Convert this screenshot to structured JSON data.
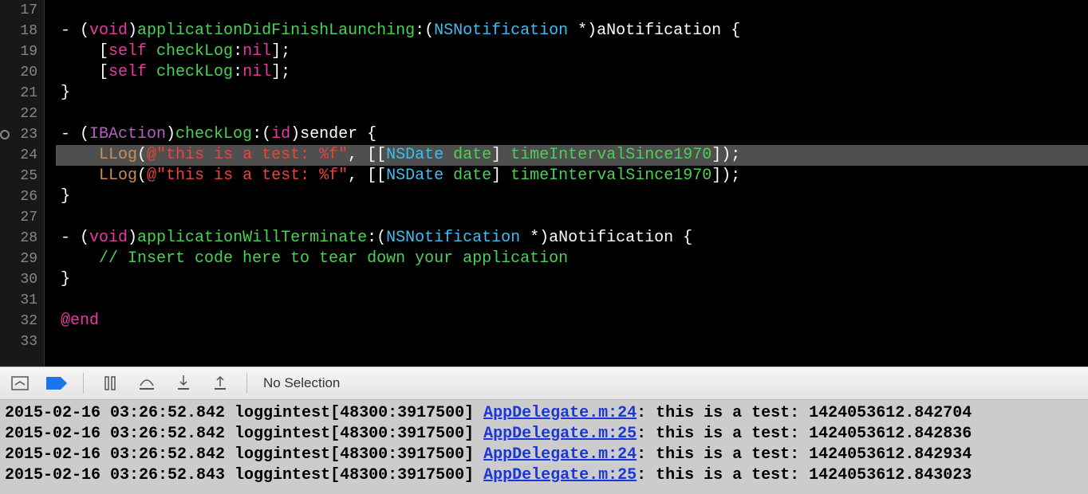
{
  "editor": {
    "line_numbers": [
      "17",
      "18",
      "19",
      "20",
      "21",
      "22",
      "23",
      "24",
      "25",
      "26",
      "27",
      "28",
      "29",
      "30",
      "31",
      "32",
      "33"
    ],
    "breakpoint_line_index": 6,
    "highlight_line_index": 7,
    "lines": [
      {
        "tokens": []
      },
      {
        "tokens": [
          {
            "t": "- (",
            "c": "k-plain"
          },
          {
            "t": "void",
            "c": "k-void"
          },
          {
            "t": ")",
            "c": "k-plain"
          },
          {
            "t": "applicationDidFinishLaunching",
            "c": "k-type"
          },
          {
            "t": ":(",
            "c": "k-plain"
          },
          {
            "t": "NSNotification",
            "c": "k-typeNS"
          },
          {
            "t": " *)aNotification {",
            "c": "k-plain"
          }
        ]
      },
      {
        "tokens": [
          {
            "t": "    [",
            "c": "k-plain"
          },
          {
            "t": "self",
            "c": "k-self"
          },
          {
            "t": " ",
            "c": "k-plain"
          },
          {
            "t": "checkLog",
            "c": "k-msg"
          },
          {
            "t": ":",
            "c": "k-plain"
          },
          {
            "t": "nil",
            "c": "k-nil"
          },
          {
            "t": "];",
            "c": "k-plain"
          }
        ]
      },
      {
        "tokens": [
          {
            "t": "    [",
            "c": "k-plain"
          },
          {
            "t": "self",
            "c": "k-self"
          },
          {
            "t": " ",
            "c": "k-plain"
          },
          {
            "t": "checkLog",
            "c": "k-msg"
          },
          {
            "t": ":",
            "c": "k-plain"
          },
          {
            "t": "nil",
            "c": "k-nil"
          },
          {
            "t": "];",
            "c": "k-plain"
          }
        ]
      },
      {
        "tokens": [
          {
            "t": "}",
            "c": "k-plain"
          }
        ]
      },
      {
        "tokens": []
      },
      {
        "tokens": [
          {
            "t": "- (",
            "c": "k-plain"
          },
          {
            "t": "IBAction",
            "c": "k-ib"
          },
          {
            "t": ")",
            "c": "k-plain"
          },
          {
            "t": "checkLog",
            "c": "k-type"
          },
          {
            "t": ":(",
            "c": "k-plain"
          },
          {
            "t": "id",
            "c": "k-id"
          },
          {
            "t": ")sender {",
            "c": "k-plain"
          }
        ]
      },
      {
        "tokens": [
          {
            "t": "    ",
            "c": "k-plain"
          },
          {
            "t": "LLog",
            "c": "k-llog"
          },
          {
            "t": "(",
            "c": "k-plain"
          },
          {
            "t": "@\"this is a test: %f\"",
            "c": "k-str"
          },
          {
            "t": ", [[",
            "c": "k-plain"
          },
          {
            "t": "NSDate",
            "c": "k-typeNS"
          },
          {
            "t": " ",
            "c": "k-plain"
          },
          {
            "t": "date",
            "c": "k-msg"
          },
          {
            "t": "] ",
            "c": "k-plain"
          },
          {
            "t": "timeIntervalSince1970",
            "c": "k-msg"
          },
          {
            "t": "]);",
            "c": "k-plain"
          }
        ]
      },
      {
        "tokens": [
          {
            "t": "    ",
            "c": "k-plain"
          },
          {
            "t": "LLog",
            "c": "k-llog"
          },
          {
            "t": "(",
            "c": "k-plain"
          },
          {
            "t": "@\"this is a test: %f\"",
            "c": "k-str"
          },
          {
            "t": ", [[",
            "c": "k-plain"
          },
          {
            "t": "NSDate",
            "c": "k-typeNS"
          },
          {
            "t": " ",
            "c": "k-plain"
          },
          {
            "t": "date",
            "c": "k-msg"
          },
          {
            "t": "] ",
            "c": "k-plain"
          },
          {
            "t": "timeIntervalSince1970",
            "c": "k-msg"
          },
          {
            "t": "]);",
            "c": "k-plain"
          }
        ]
      },
      {
        "tokens": [
          {
            "t": "}",
            "c": "k-plain"
          }
        ]
      },
      {
        "tokens": []
      },
      {
        "tokens": [
          {
            "t": "- (",
            "c": "k-plain"
          },
          {
            "t": "void",
            "c": "k-void"
          },
          {
            "t": ")",
            "c": "k-plain"
          },
          {
            "t": "applicationWillTerminate",
            "c": "k-type"
          },
          {
            "t": ":(",
            "c": "k-plain"
          },
          {
            "t": "NSNotification",
            "c": "k-typeNS"
          },
          {
            "t": " *)aNotification {",
            "c": "k-plain"
          }
        ]
      },
      {
        "tokens": [
          {
            "t": "    // Insert code here to tear down your application",
            "c": "k-comment"
          }
        ]
      },
      {
        "tokens": [
          {
            "t": "}",
            "c": "k-plain"
          }
        ]
      },
      {
        "tokens": []
      },
      {
        "tokens": [
          {
            "t": "@end",
            "c": "k-end"
          }
        ]
      },
      {
        "tokens": []
      }
    ]
  },
  "debug_bar": {
    "label": "No Selection"
  },
  "console": {
    "entries": [
      {
        "prefix": "2015-02-16 03:26:52.842 loggintest[48300:3917500] ",
        "link": "AppDelegate.m:24",
        "suffix": ": this is a test: 1424053612.842704"
      },
      {
        "prefix": "2015-02-16 03:26:52.842 loggintest[48300:3917500] ",
        "link": "AppDelegate.m:25",
        "suffix": ": this is a test: 1424053612.842836"
      },
      {
        "prefix": "2015-02-16 03:26:52.842 loggintest[48300:3917500] ",
        "link": "AppDelegate.m:24",
        "suffix": ": this is a test: 1424053612.842934"
      },
      {
        "prefix": "2015-02-16 03:26:52.843 loggintest[48300:3917500] ",
        "link": "AppDelegate.m:25",
        "suffix": ": this is a test: 1424053612.843023"
      }
    ]
  }
}
